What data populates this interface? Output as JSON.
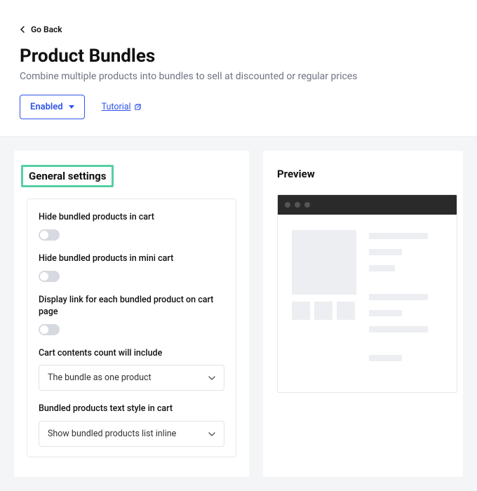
{
  "header": {
    "back_label": "Go Back",
    "title": "Product Bundles",
    "subtitle": "Combine multiple products into bundles to sell at discounted or regular prices",
    "enabled_label": "Enabled",
    "tutorial_label": "Tutorial"
  },
  "settings": {
    "section_title": "General settings",
    "items": [
      {
        "label": "Hide bundled products in cart"
      },
      {
        "label": "Hide bundled products in mini cart"
      },
      {
        "label": "Display link for each bundled product on cart page"
      }
    ],
    "cart_count": {
      "label": "Cart contents count will include",
      "value": "The bundle as one product"
    },
    "text_style": {
      "label": "Bundled products text style in cart",
      "value": "Show bundled products list inline"
    }
  },
  "preview": {
    "title": "Preview"
  }
}
